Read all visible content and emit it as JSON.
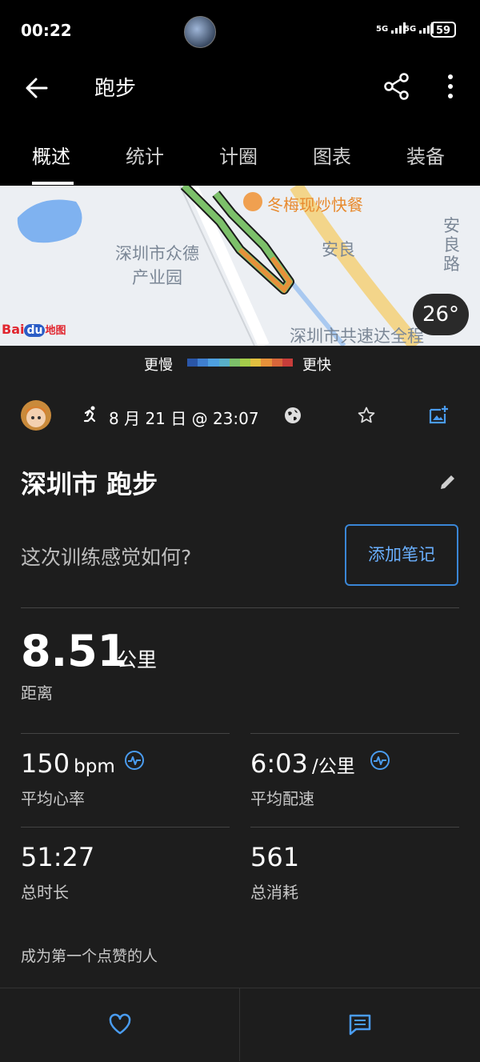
{
  "status_bar": {
    "time": "00:22",
    "battery": "59",
    "signal_1": "5G",
    "signal_2": "5G"
  },
  "header": {
    "title": "跑步"
  },
  "tabs": [
    "概述",
    "统计",
    "计圈",
    "图表",
    "装备"
  ],
  "map": {
    "poi_restaurant": "冬梅现炒快餐",
    "label_park": "深圳市众德\n产业园",
    "label_anliang": "安良",
    "label_road": "安\n良\n路",
    "label_company": "深圳市共速达全程",
    "temperature": "26°",
    "logo_text": "Bai地图",
    "logo_du": "du"
  },
  "speed_legend": {
    "slow": "更慢",
    "fast": "更快",
    "colors": [
      "#2a56a8",
      "#3f7fd0",
      "#4ea0e0",
      "#58b0c8",
      "#7cc06a",
      "#a4cc4a",
      "#e2c040",
      "#e6913a",
      "#d8663a",
      "#c73d3a"
    ]
  },
  "activity": {
    "datetime": "8 月 21 日 @ 23:07",
    "title": "深圳市 跑步",
    "feeling_prompt": "这次训练感觉如何?",
    "add_note": "添加笔记"
  },
  "stats": {
    "distance": {
      "value": "8.51",
      "unit": "公里",
      "label": "距离"
    },
    "avg_hr": {
      "value": "150",
      "unit": "bpm",
      "label": "平均心率"
    },
    "avg_pace": {
      "value": "6:03",
      "unit": "/公里",
      "label": "平均配速"
    },
    "duration": {
      "value": "51:27",
      "label": "总时长"
    },
    "calories": {
      "value": "561",
      "label": "总消耗"
    }
  },
  "likes_text": "成为第一个点赞的人",
  "colors": {
    "accent_blue": "#3a86d6",
    "background": "#1d1d1d"
  }
}
